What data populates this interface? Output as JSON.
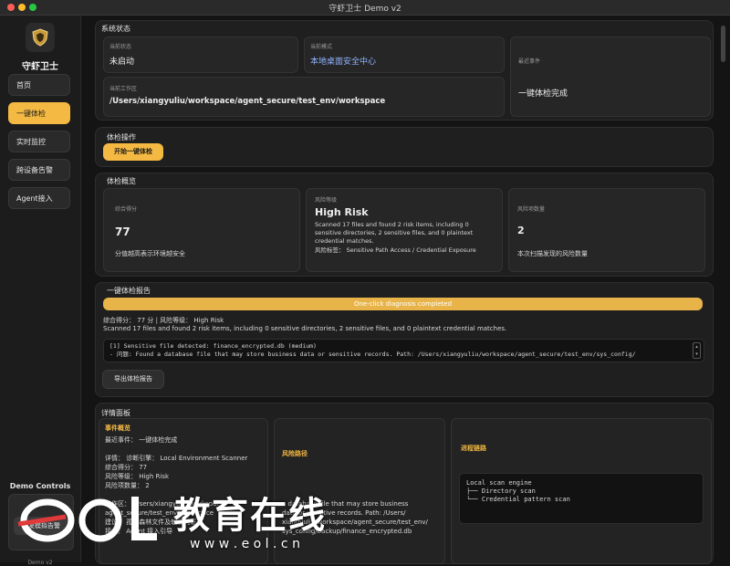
{
  "window": {
    "title": "守虾卫士 Demo v2"
  },
  "sidebar": {
    "app_name": "守虾卫士",
    "items": [
      {
        "label": "首页",
        "active": false
      },
      {
        "label": "一键体检",
        "active": true
      },
      {
        "label": "实时监控",
        "active": false
      },
      {
        "label": "跨设备告警",
        "active": false
      },
      {
        "label": "Agent接入",
        "active": false
      }
    ],
    "demo_title": "Demo Controls",
    "demo_button": "触发模拟告警",
    "demo_footer": "Demo v2"
  },
  "status": {
    "title": "系统状态",
    "current_state_label": "当前状态",
    "current_state": "未启动",
    "current_mode_label": "当前模式",
    "current_mode": "本地桌面安全中心",
    "recent_event_label": "最近事件",
    "recent_event": "一键体检完成",
    "workdir_label": "当前工作区",
    "workdir": "/Users/xiangyuliu/workspace/agent_secure/test_env/workspace"
  },
  "ops": {
    "title": "体检操作",
    "start_button": "开始一键体检"
  },
  "overview": {
    "title": "体检概览",
    "score_label": "综合得分",
    "score": "77",
    "score_desc": "分值越高表示环境越安全",
    "risk_label": "风险等级",
    "risk": "High Risk",
    "risk_desc": "Scanned 17 files and found 2 risk items, including 0 sensitive directories, 2 sensitive files, and 0 plaintext credential matches.",
    "risk_tags": "风险标签： Sensitive Path Access / Credential Exposure",
    "count_label": "风险项数量",
    "count": "2",
    "count_desc": "本次扫描发现的风险数量"
  },
  "report": {
    "title": "一键体检报告",
    "progress_text": "One-click diagnosis completed",
    "progress": 1.0,
    "summary": "综合得分： 77 分 | 风险等级： High Risk",
    "detail": "Scanned 17 files and found 2 risk items, including 0 sensitive directories, 2 sensitive files, and 0 plaintext credential matches.",
    "log_line1": "[1] Sensitive file detected: finance_encrypted.db (medium)",
    "log_line2": "- 问题: Found a database file that may store business data or sensitive records. Path: /Users/xiangyuliu/workspace/agent_secure/test_env/sys_config/",
    "export_button": "导出体检报告"
  },
  "details": {
    "title": "详情面板",
    "event_title": "事件概览",
    "event_lines": [
      "最近事件： 一键体检完成",
      "",
      "详情： 诊断引擎： Local Environment Scanner",
      "综合得分： 77",
      "风险等级： High Risk",
      "风险项数量： 2",
      "",
      "工作区： /Users/xiangyuliu/workspace/",
      "agent_secure/test_env/workspace",
      "建议： 孤立森林文件及敏感凭证",
      "接入： Agent 接入引导"
    ],
    "path_title": "风险路径",
    "path_lines": [
      "a database file that may store business",
      "data or sensitive records. Path: /Users/",
      "xiangyuliu/workspace/agent_secure/test_env/",
      "sys_config/backup/finance_encrypted.db"
    ],
    "chain_title": "进程链路",
    "chain_lines": [
      "Local scan engine",
      "├── Directory scan",
      "└── Credential pattern scan"
    ]
  },
  "watermark": {
    "brand": "教育在线",
    "url": "w w w . e o l . c n"
  },
  "colors": {
    "accent": "#f4b942",
    "link": "#8fb4ff",
    "background": "#141414"
  }
}
